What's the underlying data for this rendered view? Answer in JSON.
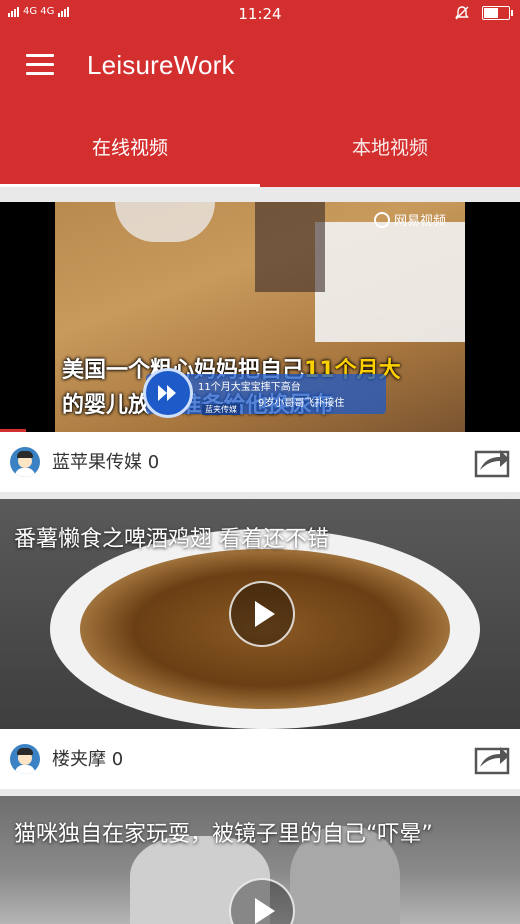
{
  "status_bar": {
    "network": "4G 4G",
    "time": "11:24"
  },
  "app_bar": {
    "title": "LeisureWork"
  },
  "tabs": [
    {
      "label": "在线视频",
      "selected": true
    },
    {
      "label": "本地视频",
      "selected": false
    }
  ],
  "videos": [
    {
      "author": "蓝苹果传媒 0",
      "watermark": "网易视频",
      "subtitle_line1": "美国一个粗心妈妈把自己11个月大",
      "subtitle_line2": "的婴儿放 上准备给他换尿布",
      "subtitle_highlight": "11个月大",
      "banner_line1": "11个月大宝宝摔下高台",
      "banner_line2": "9岁小哥哥飞扑接住",
      "banner_source": "蓝夹传媒"
    },
    {
      "title": "番薯懒食之啤酒鸡翅 看着还不错",
      "author": "楼夹摩 0"
    },
    {
      "title": "猫咪独自在家玩耍，被镜子里的自己“吓晕”"
    }
  ],
  "colors": {
    "primary": "#d32f2f",
    "background": "#e9e9e9",
    "highlight_text": "#ffd000"
  }
}
